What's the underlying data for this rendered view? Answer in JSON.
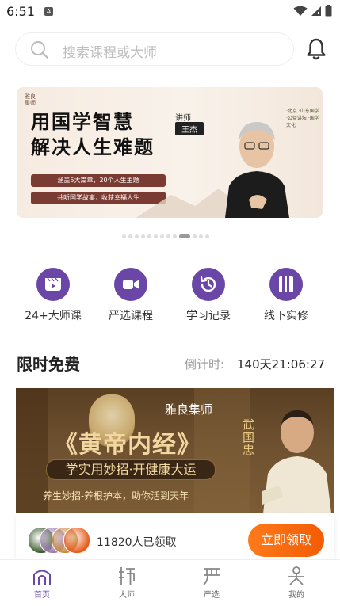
{
  "status_bar": {
    "time": "6:51",
    "notification_badge": "A"
  },
  "search": {
    "placeholder": "搜索课程或大师"
  },
  "banner": {
    "logo_text": "雅良集师",
    "headline_line1": "用国学智慧",
    "headline_line2": "解决人生难题",
    "pill1": "涵盖5大篇章，20个人生主题",
    "pill2": "共听国学故事，收获幸福人生",
    "lecturer_label": "讲师",
    "lecturer_name": "王杰",
    "side_text": "·北京 ·山东国学 ·公益讲坛 ·国学文化"
  },
  "carousel": {
    "total": 13,
    "active_index": 9
  },
  "shortcuts": [
    {
      "label": "24+大师课",
      "icon": "video-play-icon"
    },
    {
      "label": "严选课程",
      "icon": "video-camera-icon"
    },
    {
      "label": "学习记录",
      "icon": "history-clock-icon"
    },
    {
      "label": "线下实修",
      "icon": "book-icon"
    }
  ],
  "free_section": {
    "title": "限时免费",
    "countdown_label": "倒计时:",
    "countdown_value": "140天21:06:27"
  },
  "course": {
    "brand": "雅良集师",
    "title": "《黄帝内经》",
    "subtitle": "学实用妙招·开健康大运",
    "subtitle2": "养生妙招-养根护本，助你活到天年",
    "lecturer_tag": "武国忠"
  },
  "claim": {
    "count_text": "11820人已领取",
    "button_label": "立即领取",
    "avatar_colors": [
      "#3a5a2a",
      "#9c7bb0",
      "#c98a3e",
      "#e65a1a"
    ]
  },
  "tabbar": [
    {
      "label": "首页",
      "icon": "home-icon",
      "active": true
    },
    {
      "label": "大师",
      "icon": "master-icon",
      "active": false
    },
    {
      "label": "严选",
      "icon": "selection-icon",
      "active": false
    },
    {
      "label": "我的",
      "icon": "profile-icon",
      "active": false
    }
  ],
  "colors": {
    "accent": "#6a47a6",
    "cta": "#f25c05"
  }
}
